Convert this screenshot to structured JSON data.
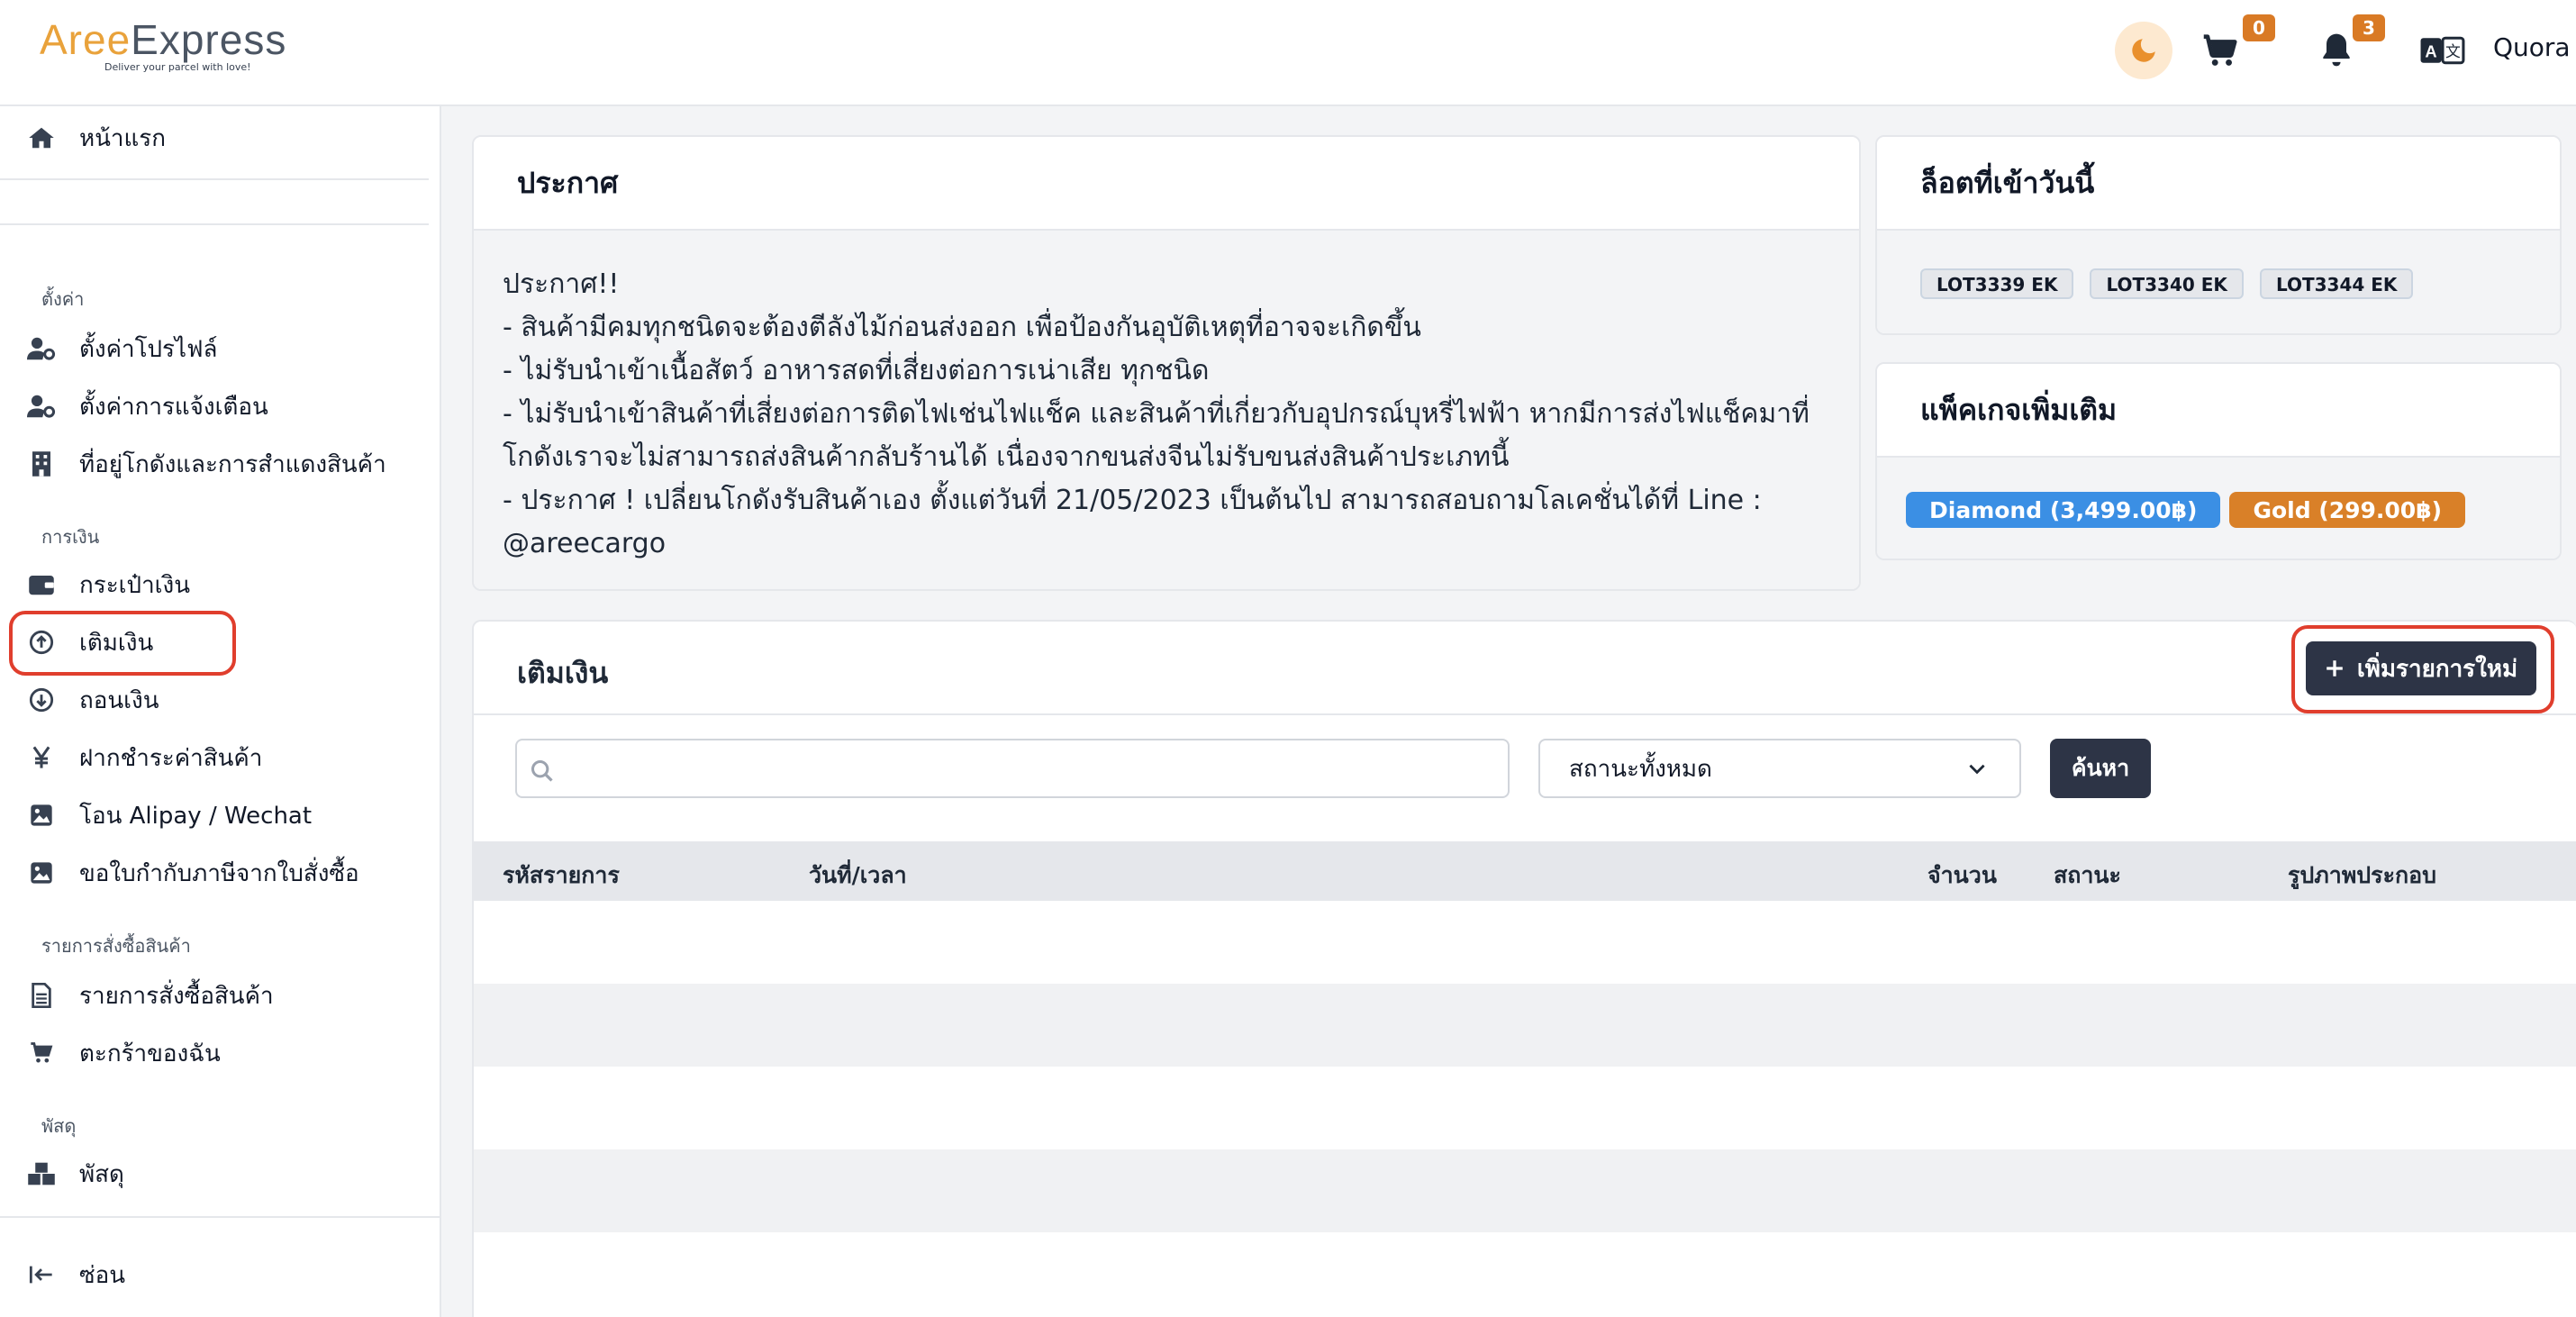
{
  "header": {
    "logo_part1": "Aree",
    "logo_part2": "Express",
    "tagline": "Deliver your parcel with love!",
    "cart_count": "0",
    "notification_count": "3",
    "user_name": "Quora"
  },
  "sidebar": {
    "home": "หน้าแรก",
    "section_settings": "ตั้งค่า",
    "profile_settings": "ตั้งค่าโปรไฟล์",
    "notification_settings": "ตั้งค่าการแจ้งเตือน",
    "warehouse_address": "ที่อยู่โกดังและการสำแดงสินค้า",
    "section_finance": "การเงิน",
    "wallet": "กระเป๋าเงิน",
    "topup": "เติมเงิน",
    "withdraw": "ถอนเงิน",
    "pay_deposit": "ฝากชำระค่าสินค้า",
    "alipay_transfer": "โอน Alipay / Wechat",
    "tax_invoice": "ขอใบกำกับภาษีจากใบสั่งซื้อ",
    "section_orders": "รายการสั่งซื้อสินค้า",
    "orders": "รายการสั่งซื้อสินค้า",
    "my_cart": "ตะกร้าของฉัน",
    "section_parcels": "พัสดุ",
    "parcels": "พัสดุ",
    "hide": "ซ่อน"
  },
  "announcement": {
    "title": "ประกาศ",
    "lines": [
      "ประกาศ!!",
      "- สินค้ามีคมทุกชนิดจะต้องตีลังไม้ก่อนส่งออก เพื่อป้องกันอุบัติเหตุที่อาจจะเกิดขึ้น",
      "- ไม่รับนำเข้าเนื้อสัตว์ อาหารสดที่เสี่ยงต่อการเน่าเสีย ทุกชนิด",
      "- ไม่รับนำเข้าสินค้าที่เสี่ยงต่อการติดไฟเช่นไฟแช็ค และสินค้าที่เกี่ยวกับอุปกรณ์บุหรี่ไฟฟ้า หากมีการส่งไฟแช็คมาที่",
      "โกดังเราจะไม่สามารถส่งสินค้ากลับร้านได้ เนื่องจากขนส่งจีนไม่รับขนส่งสินค้าประเภทนี้",
      "- ประกาศ ! เปลี่ยนโกดังรับสินค้าเอง ตั้งแต่วันที่ 21/05/2023 เป็นต้นไป สามารถสอบถามโลเคชั่นได้ที่ Line :",
      "@areecargo"
    ]
  },
  "lots": {
    "title": "ล็อตที่เข้าวันนี้",
    "items": [
      "LOT3339 EK",
      "LOT3340 EK",
      "LOT3344 EK"
    ]
  },
  "packages": {
    "title": "แพ็คเกจเพิ่มเติม",
    "items": [
      {
        "label": "Diamond (3,499.00฿)",
        "color": "#3b8fe4"
      },
      {
        "label": "Gold (299.00฿)",
        "color": "#d98028"
      }
    ]
  },
  "topup": {
    "title": "เติมเงิน",
    "add_button": "เพิ่มรายการใหม่",
    "search_placeholder": "",
    "status_select": "สถานะทั้งหมด",
    "search_button": "ค้นหา",
    "columns": [
      "รหัสรายการ",
      "วันที่/เวลา",
      "จำนวน",
      "สถานะ",
      "รูปภาพประกอบ"
    ]
  },
  "colors": {
    "accent_dark": "#2d3446",
    "brand_orange": "#e9a23b",
    "highlight_red": "#e03e2d"
  }
}
